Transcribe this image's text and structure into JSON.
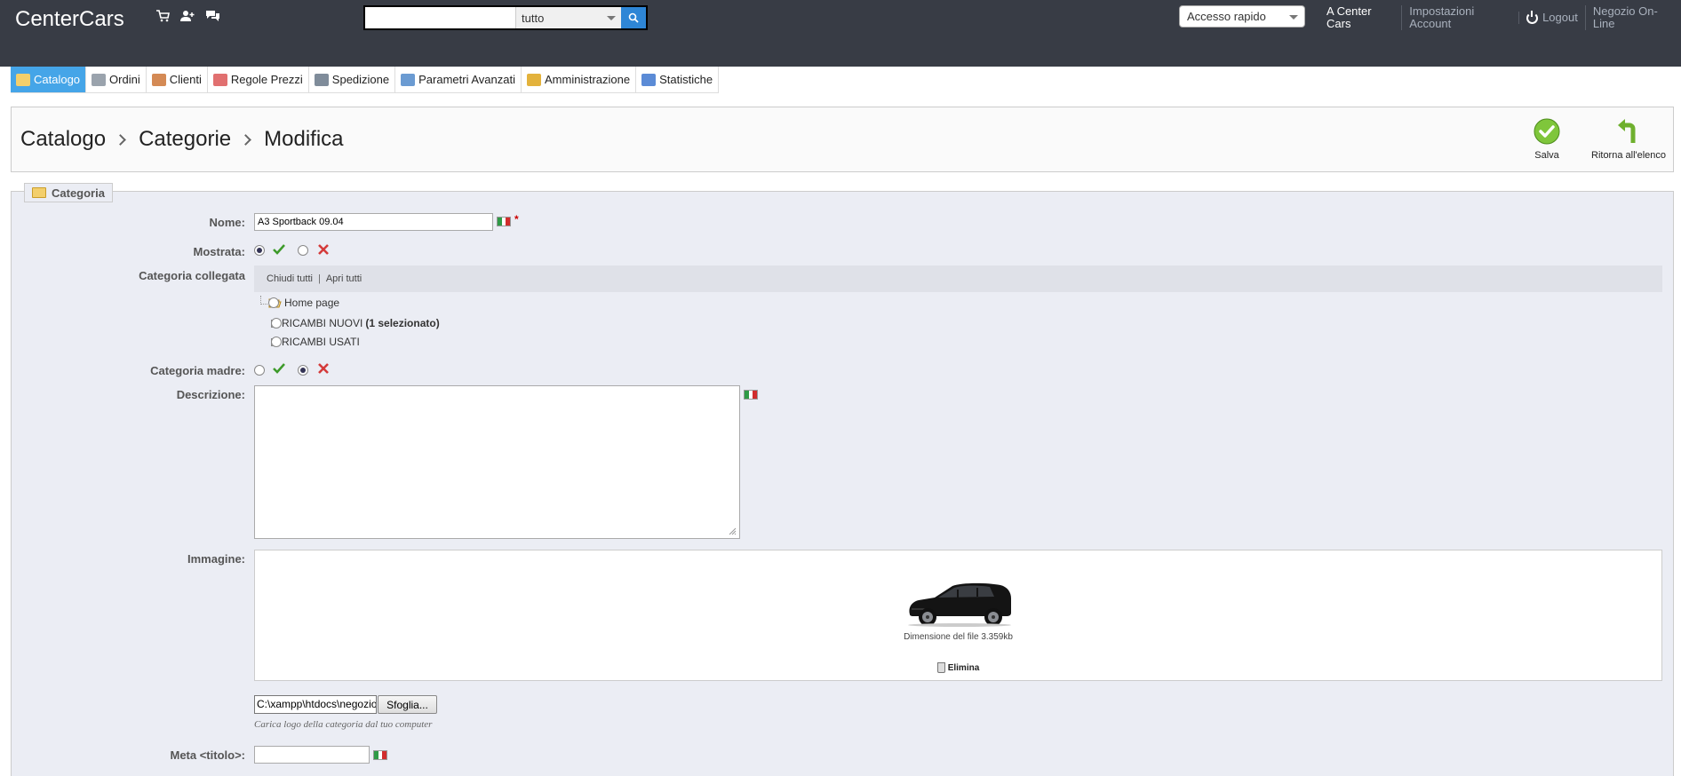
{
  "header": {
    "logo": "CenterCars",
    "search_value": "",
    "search_scope": "tutto",
    "quick_access": "Accesso rapido",
    "links": {
      "shop_name": "A Center Cars",
      "account": "Impostazioni Account",
      "logout": "Logout",
      "store": "Negozio On-Line"
    }
  },
  "nav": [
    {
      "label": "Catalogo",
      "icon": "folder-icon",
      "color": "#f3cf6c"
    },
    {
      "label": "Ordini",
      "icon": "cart-icon",
      "color": "#9aa3ad"
    },
    {
      "label": "Clienti",
      "icon": "user-icon",
      "color": "#d48a55"
    },
    {
      "label": "Regole Prezzi",
      "icon": "price-rules-icon",
      "color": "#e17070"
    },
    {
      "label": "Spedizione",
      "icon": "truck-icon",
      "color": "#7f8c9a"
    },
    {
      "label": "Parametri Avanzati",
      "icon": "wrench-icon",
      "color": "#6b9bd2"
    },
    {
      "label": "Amministrazione",
      "icon": "key-icon",
      "color": "#e3b23c"
    },
    {
      "label": "Statistiche",
      "icon": "chart-icon",
      "color": "#5b8bd6"
    }
  ],
  "breadcrumb": [
    "Catalogo",
    "Categorie",
    "Modifica"
  ],
  "toolbar": {
    "save": "Salva",
    "back": "Ritorna all'elenco"
  },
  "form": {
    "legend": "Categoria",
    "name_label": "Nome:",
    "name_value": "A3 Sportback 09.04",
    "required_mark": "*",
    "shown_label": "Mostrata:",
    "linked_label": "Categoria collegata",
    "collapse_all": "Chiudi tutti",
    "expand_all": "Apri tutti",
    "tree": {
      "home": "Home page",
      "new_parts": "RICAMBI NUOVI",
      "new_parts_selected": "(1 selezionato)",
      "used_parts": "RICAMBI USATI"
    },
    "root_label": "Categoria madre:",
    "description_label": "Descrizione:",
    "image_label": "Immagine:",
    "file_size": "Dimensione del file 3.359kb",
    "delete": "Elimina",
    "file_path": "C:\\xampp\\htdocs\\negozio",
    "browse": "Sfoglia...",
    "upload_hint": "Carica logo della categoria dal tuo computer",
    "meta_title_label": "Meta <titolo>:",
    "meta_title_value": ""
  }
}
